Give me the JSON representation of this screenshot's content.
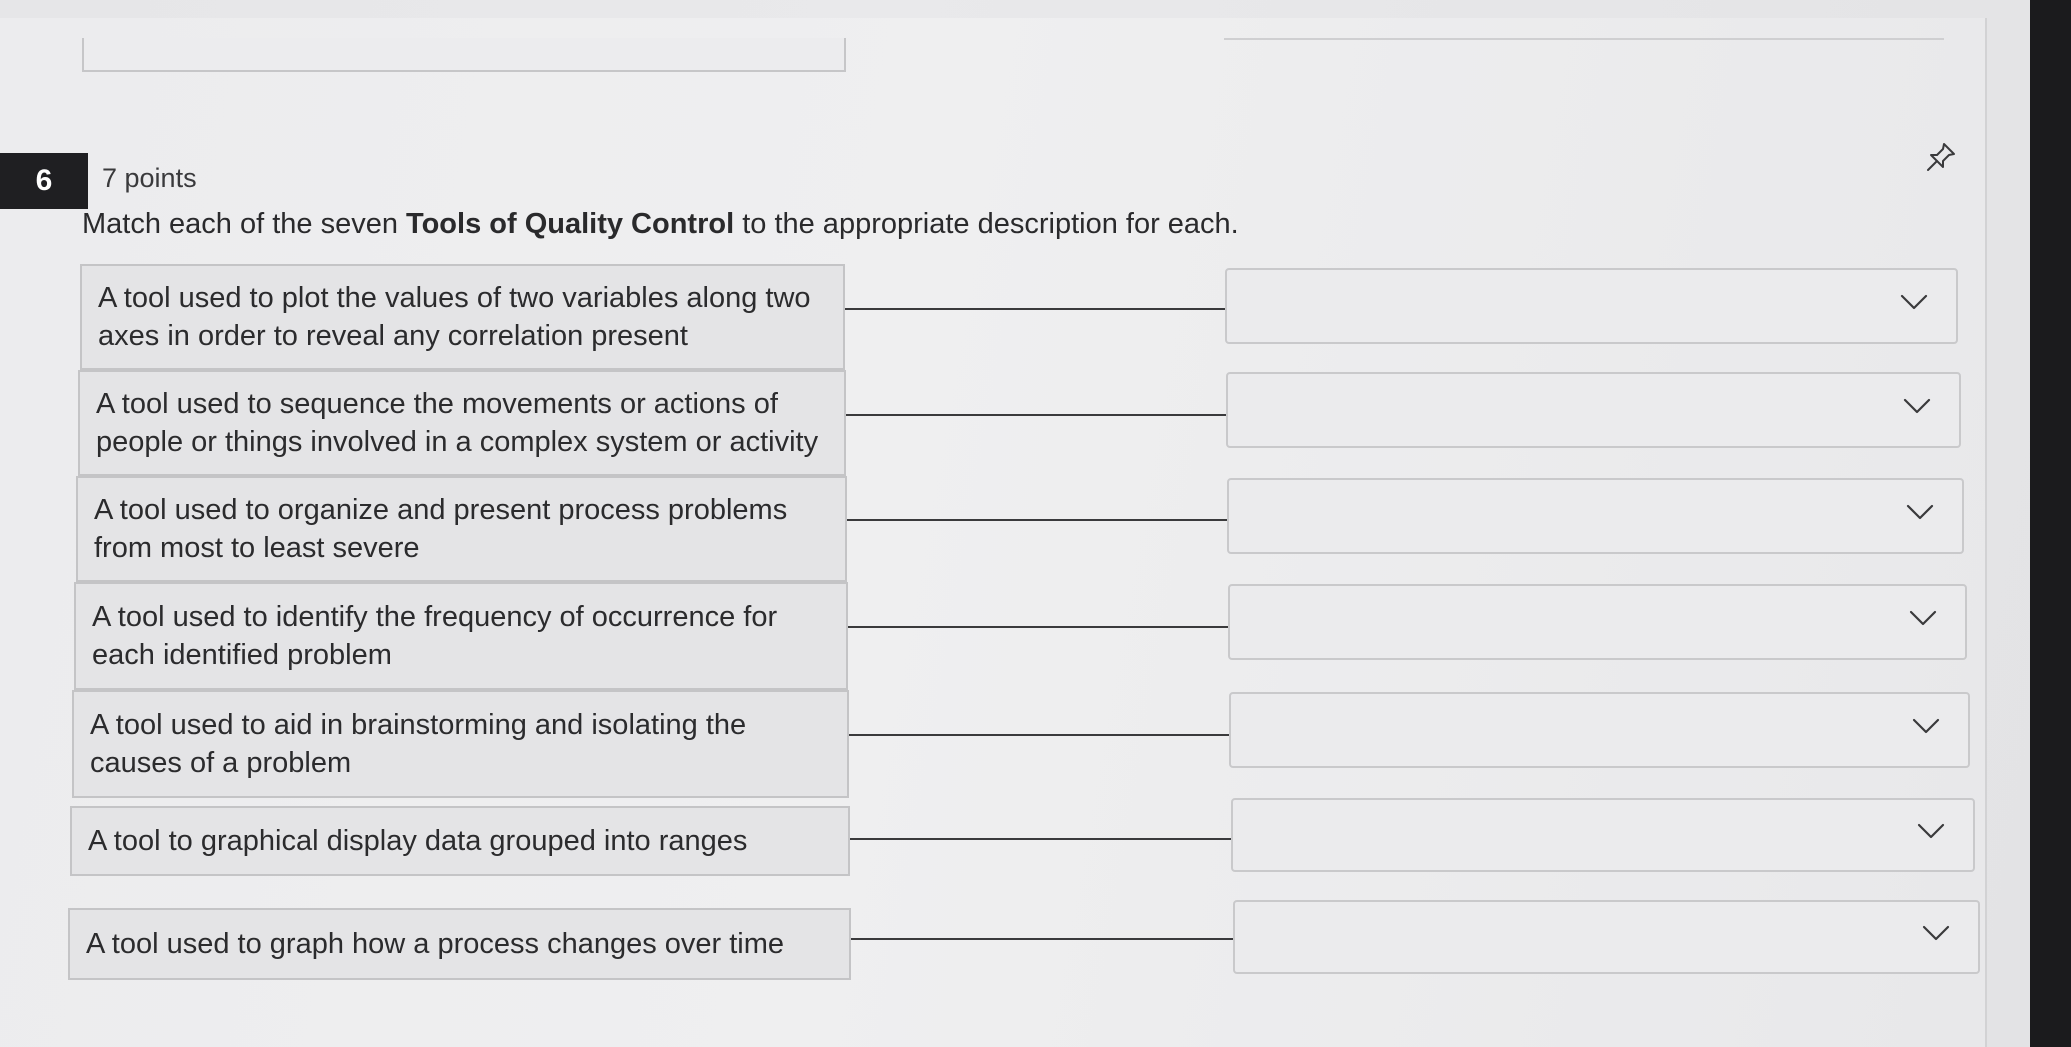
{
  "question": {
    "number": "6",
    "points": "7 points",
    "prompt_start": "Match each of the seven ",
    "prompt_bold": "Tools of Quality Control",
    "prompt_end": " to the appropriate description for each."
  },
  "pairs": [
    {
      "description": "A tool used to plot the values of two variables along two axes in order to reveal any correlation present",
      "selected": ""
    },
    {
      "description": "A tool used to sequence the movements or actions of people or things involved in a complex system or activity",
      "selected": ""
    },
    {
      "description": "A tool used to organize and present process problems from most to least severe",
      "selected": ""
    },
    {
      "description": "A tool used to identify the frequency of occurrence for each identified problem",
      "selected": ""
    },
    {
      "description": "A tool used to aid in brainstorming and isolating the causes of a problem",
      "selected": ""
    },
    {
      "description": "A tool to graphical display data grouped into ranges",
      "selected": ""
    },
    {
      "description": "A tool used to graph how a process changes over time",
      "selected": ""
    }
  ],
  "icons": {
    "pin": "pin-icon",
    "dropdown": "chevron-down-icon"
  },
  "colors": {
    "number_badge_bg": "#1f1f22",
    "number_badge_text": "#ffffff"
  }
}
